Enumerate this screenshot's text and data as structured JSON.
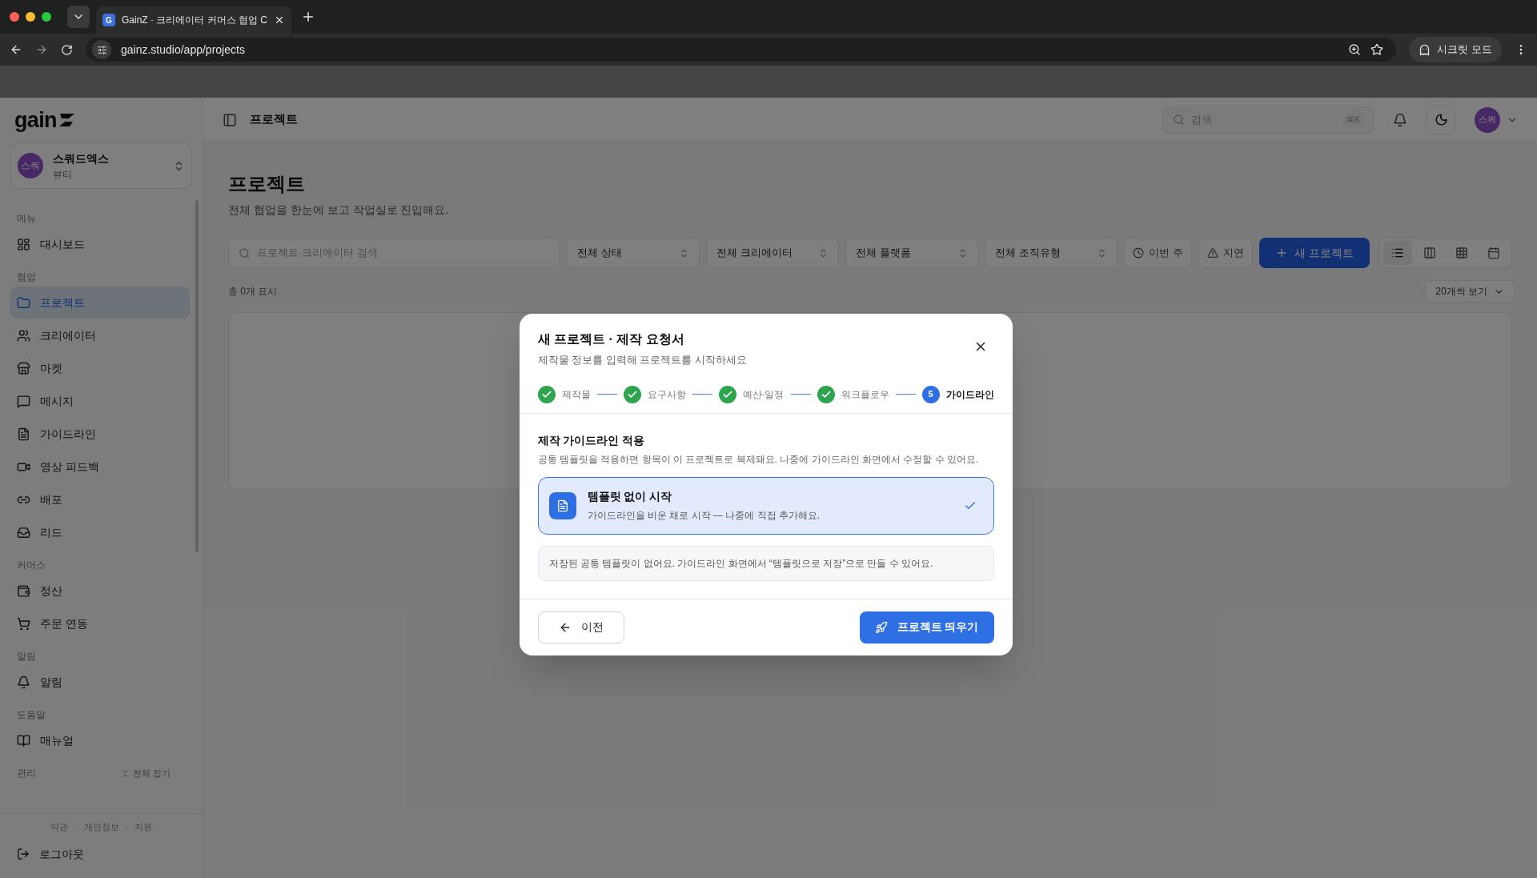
{
  "browser": {
    "tab_title": "GainZ · 크리에이터 커머스 협업 C",
    "favicon": "G",
    "url": "gainz.studio/app/projects",
    "incognito": "시크릿 모드"
  },
  "sidebar": {
    "logo": "gain",
    "org": {
      "avatar": "스쿼",
      "name": "스쿼드엑스",
      "category": "뷰티"
    },
    "sections": [
      {
        "label": "메뉴",
        "items": [
          {
            "label": "대시보드",
            "selected": false
          }
        ]
      },
      {
        "label": "협업",
        "items": [
          {
            "label": "프로젝트",
            "selected": true
          },
          {
            "label": "크리에이터",
            "selected": false
          },
          {
            "label": "마켓",
            "selected": false
          },
          {
            "label": "메시지",
            "selected": false
          },
          {
            "label": "가이드라인",
            "selected": false
          },
          {
            "label": "영상 피드백",
            "selected": false
          },
          {
            "label": "배포",
            "selected": false
          },
          {
            "label": "리드",
            "selected": false
          }
        ]
      },
      {
        "label": "커머스",
        "items": [
          {
            "label": "정산",
            "selected": false
          },
          {
            "label": "주문 연동",
            "selected": false
          }
        ]
      },
      {
        "label": "알림",
        "items": [
          {
            "label": "알림",
            "selected": false
          }
        ]
      },
      {
        "label": "도움말",
        "items": [
          {
            "label": "매뉴얼",
            "selected": false
          }
        ]
      },
      {
        "label": "관리"
      }
    ],
    "collapse_all": "전체 접기",
    "footer_links": [
      "약관",
      "개인정보",
      "지원"
    ],
    "footer_separator": "·",
    "logout": "로그아웃"
  },
  "header": {
    "title": "프로젝트",
    "search_placeholder": "검색",
    "shortcut": "⌘K",
    "avatar": "스쿼"
  },
  "page": {
    "title": "프로젝트",
    "subtitle": "전체 협업을 한눈에 보고 작업실로 진입해요.",
    "search_placeholder": "프로젝트·크리에이터 검색",
    "selects": [
      "전체 상태",
      "전체 크리에이터",
      "전체 플랫폼",
      "전체 조직유형"
    ],
    "toggles": [
      "이번 주",
      "지연"
    ],
    "new_button": "새 프로젝트",
    "views": [
      {
        "selected": true
      },
      {
        "selected": false
      },
      {
        "selected": false
      },
      {
        "selected": false
      }
    ],
    "count": "총 0개 표시",
    "page_size": "20개씩 보기"
  },
  "modal": {
    "title": "새 프로젝트 · 제작 요청서",
    "subtitle": "제작물 정보를 입력해 프로젝트를 시작하세요",
    "steps": [
      {
        "label": "제작물",
        "done": true,
        "selected": false
      },
      {
        "label": "요구사항",
        "done": true,
        "selected": false
      },
      {
        "label": "예산·일정",
        "done": true,
        "selected": false
      },
      {
        "label": "워크플로우",
        "done": true,
        "selected": false
      },
      {
        "label": "가이드라인",
        "done": false,
        "selected": true,
        "number": "5"
      }
    ],
    "section_title": "제작 가이드라인 적용",
    "section_desc": "공통 템플릿을 적용하면 항목이 이 프로젝트로 복제돼요. 나중에 가이드라인 화면에서 수정할 수 있어요.",
    "option": {
      "title": "템플릿 없이 시작",
      "description": "가이드라인을 비운 채로 시작 — 나중에 직접 추가해요.",
      "selected": true
    },
    "note": "저장된 공통 템플릿이 없어요. 가이드라인 화면에서 “템플릿으로 저장”으로 만들 수 있어요.",
    "back": "이전",
    "submit": "프로젝트 띄우기"
  }
}
